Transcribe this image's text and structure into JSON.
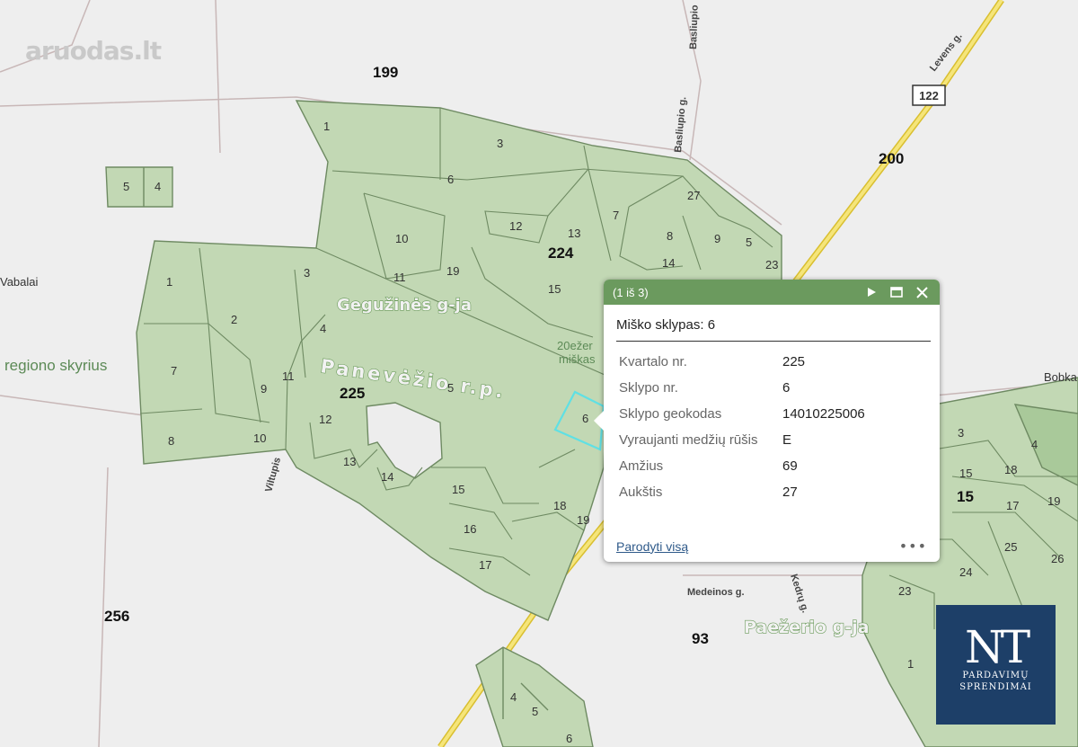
{
  "brand": {
    "watermark": "aruodas.lt",
    "badge_big": "NT",
    "badge_line1": "PARDAVIMŲ",
    "badge_line2": "SPRENDIMAI"
  },
  "map": {
    "quarter_labels": [
      "199",
      "200",
      "224",
      "225",
      "256",
      "93",
      "15"
    ],
    "area_labels": [
      "Gegužinės g-ja",
      "Panevėžio r.p.",
      "Paežerio g-ja"
    ],
    "place_labels": [
      "Vabalai",
      "regiono skyrius",
      "Bobka",
      "20ežer",
      "miškas"
    ],
    "street_labels": [
      "Basliupio",
      "Basliupio g.",
      "Levens g.",
      "Viltupis",
      "Medeinos g.",
      "Kedrų g."
    ],
    "road_number": "122",
    "parcel_numbers": [
      "1",
      "2",
      "3",
      "4",
      "5",
      "6",
      "7",
      "8",
      "9",
      "10",
      "11",
      "12",
      "13",
      "14",
      "15",
      "16",
      "17",
      "18",
      "19",
      "23",
      "24",
      "25",
      "26",
      "27"
    ],
    "colors": {
      "forest": "#c2d8b4",
      "forest_border": "#6e8a62",
      "highlight": "#5fe0e4",
      "road": "#f5d84a",
      "popup_header": "#6b9a5e"
    }
  },
  "popup": {
    "counter": "(1 iš 3)",
    "title": "Miško sklypas: 6",
    "rows": [
      {
        "key": "Kvartalo nr.",
        "value": "225"
      },
      {
        "key": "Sklypo nr.",
        "value": "6"
      },
      {
        "key": "Sklypo geokodas",
        "value": "14010225006"
      },
      {
        "key": "Vyraujanti medžių rūšis",
        "value": "E"
      },
      {
        "key": "Amžius",
        "value": "69"
      },
      {
        "key": "Aukštis",
        "value": "27"
      }
    ],
    "show_all": "Parodyti visą",
    "more": "•••",
    "icons": [
      "play-icon",
      "maximize-icon",
      "close-icon"
    ]
  }
}
